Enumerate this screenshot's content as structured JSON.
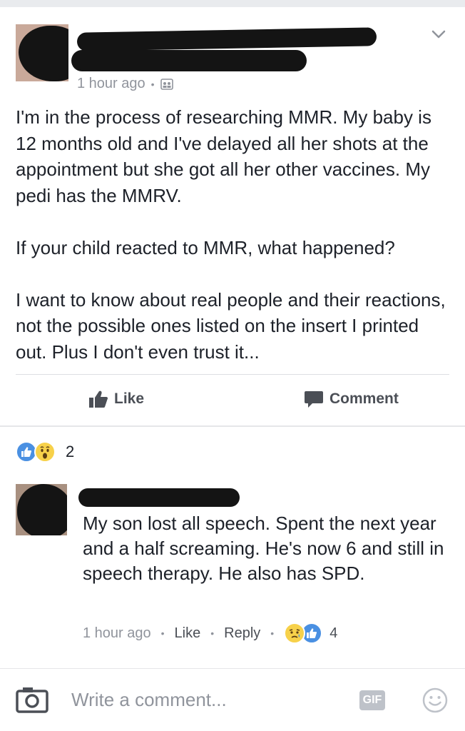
{
  "post": {
    "meta": {
      "time": "1 hour ago",
      "separator": "•",
      "audience_icon": "group-audience-icon"
    },
    "paragraphs": [
      "I'm in the process of researching MMR. My baby is 12 months old and I've delayed all her shots at the appointment but she got all her other vaccines. My pedi has the MMRV.",
      "If your child reacted to MMR, what happened?",
      "I want to know about real people and their reactions, not the possible ones listed on the insert I printed out.  Plus I don't even trust it..."
    ],
    "actions": {
      "like_label": "Like",
      "comment_label": "Comment"
    },
    "reactions": {
      "icons": [
        "like-icon",
        "wow-icon"
      ],
      "count": "2"
    }
  },
  "comment": {
    "text": "My son lost all speech. Spent the next year and a half screaming. He's now 6 and still in speech therapy. He also has SPD.",
    "meta": {
      "time": "1 hour ago",
      "like_label": "Like",
      "reply_label": "Reply",
      "separator": "•",
      "reaction_icons": [
        "sad-icon",
        "like-icon"
      ],
      "reaction_count": "4"
    }
  },
  "composer": {
    "placeholder": "Write a comment...",
    "gif_label": "GIF"
  },
  "colors": {
    "text": "#1d2129",
    "muted": "#90949c",
    "action": "#4b4f56",
    "like_blue": "#4a90e2",
    "emoji_yellow": "#f7d14a"
  }
}
